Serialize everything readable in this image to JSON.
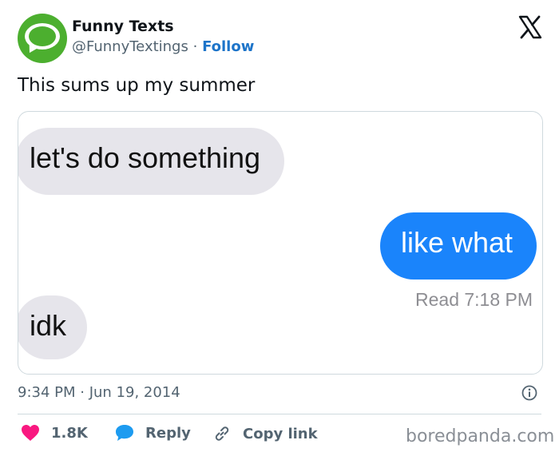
{
  "header": {
    "display_name": "Funny Texts",
    "handle": "@FunnyTextings",
    "separator": "·",
    "follow_label": "Follow"
  },
  "tweet": {
    "text": "This sums up my summer"
  },
  "media": {
    "messages": [
      {
        "side": "received",
        "text": "let's do something"
      },
      {
        "side": "sent",
        "text": "like what"
      },
      {
        "side": "received",
        "text": "idk"
      }
    ],
    "read_receipt": "Read 7:18 PM"
  },
  "meta": {
    "time": "9:34 PM · Jun 19, 2014"
  },
  "actions": {
    "likes": "1.8K",
    "reply_label": "Reply",
    "copy_link_label": "Copy link"
  },
  "watermark": "boredpanda.com",
  "colors": {
    "brand_green": "#4caf2f",
    "follow_blue": "#1d74c9",
    "imessage_blue": "#1a84fb",
    "like_pink": "#f91880",
    "reply_blue": "#1d9bf0"
  },
  "icons": {
    "close": "x-logo-icon",
    "info": "info-icon",
    "like": "heart-icon",
    "reply": "speech-bubble-icon",
    "copy": "link-icon"
  }
}
